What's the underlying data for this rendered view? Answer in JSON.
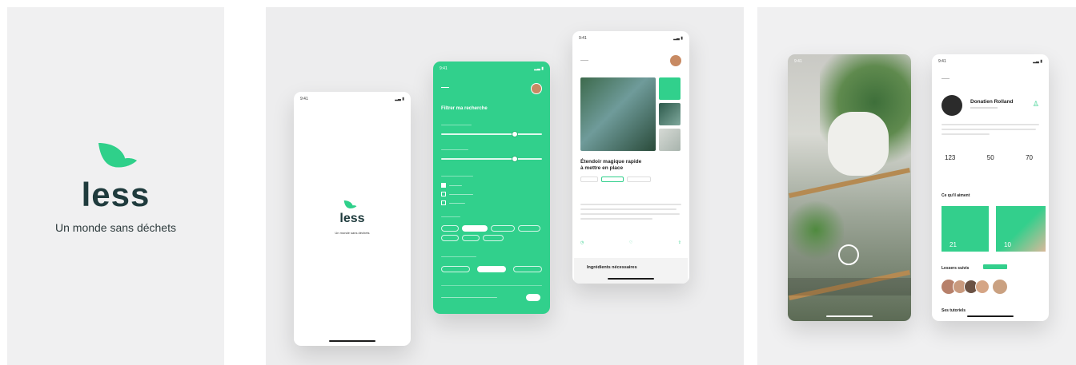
{
  "brand": {
    "name": "less",
    "tagline": "Un monde sans déchets",
    "accent": "#2fd08a",
    "dark_text": "#1f3b3d"
  },
  "splash_phone": {
    "time": "9:41",
    "name": "less",
    "tagline": "Un monde sans déchets"
  },
  "filter_phone": {
    "time": "9:41",
    "title": "Filtrer ma recherche"
  },
  "detail_phone": {
    "time": "9:41",
    "title_line1": "Étendoir magique rapide",
    "title_line2": "à mettre en place",
    "section_title": "Ingrédients nécessaires"
  },
  "camera_phone": {
    "time": "9:41"
  },
  "profile_phone": {
    "time": "9:41",
    "name": "Donatien Rolland",
    "stats": [
      "123",
      "50",
      "70"
    ],
    "section_likes": "Ce qu'il aiment",
    "card_counts": [
      "21",
      "10"
    ],
    "section_following": "Lessers suivis",
    "section_tutorials": "Ses tutoriels"
  }
}
